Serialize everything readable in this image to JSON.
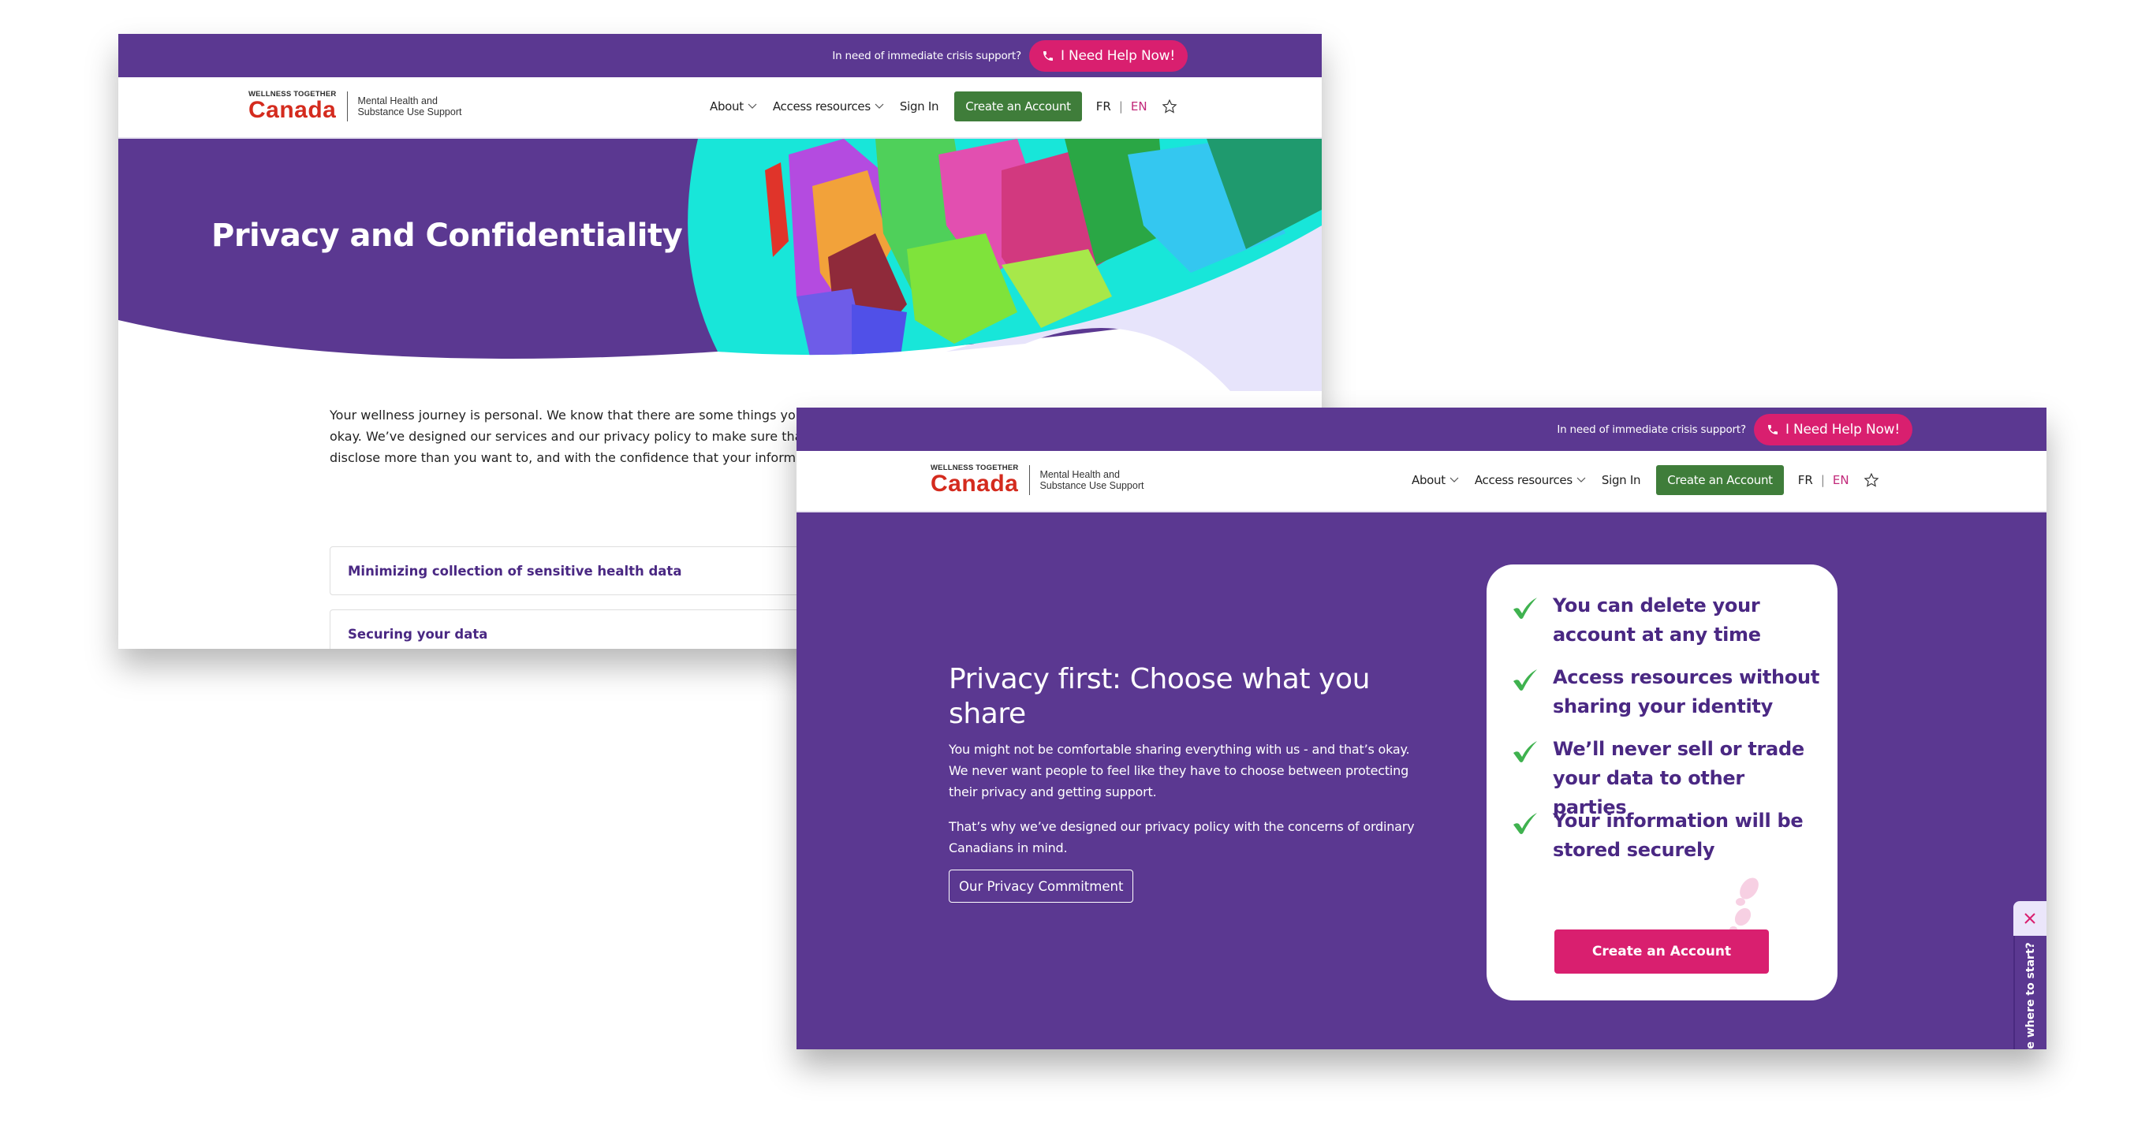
{
  "colors": {
    "brand_purple": "#5b3891",
    "text_purple": "#4a2883",
    "crisis_pink": "#d91f6f",
    "create_green": "#3f7d3a",
    "lang_active": "#c2287a",
    "check_green": "#3fb24f",
    "logo_red": "#d42b1e"
  },
  "crisis_bar": {
    "prompt": "In need of immediate crisis support?",
    "help_button": "I Need Help Now!",
    "help_icon": "phone-icon"
  },
  "header": {
    "logo": {
      "top_line": "WELLNESS TOGETHER",
      "name": "Canada",
      "subtitle_line1": "Mental Health and",
      "subtitle_line2": "Substance Use Support"
    },
    "nav": [
      {
        "label": "About",
        "icon": "chevron-down-icon"
      },
      {
        "label": "Access resources",
        "icon": "chevron-down-icon"
      },
      {
        "label": "Sign In"
      }
    ],
    "create_account": "Create an Account",
    "lang_fr": "FR",
    "lang_sep": "|",
    "lang_en": "EN",
    "favorite_icon": "star-icon"
  },
  "back_page": {
    "hero_title": "Privacy and Confidentiality",
    "intro_line1": "Your wellness journey is personal. We know that there are some things you",
    "intro_line2": "okay. We’ve designed our services and our privacy policy to make sure that",
    "intro_line3": "disclose more than you want to, and with the confidence that your informa",
    "accordion": [
      {
        "label": "Minimizing collection of sensitive health data"
      },
      {
        "label": "Securing your data"
      },
      {
        "label": ""
      }
    ]
  },
  "front_page": {
    "title": "Privacy first: Choose what you share",
    "paragraph1": "You might not be comfortable sharing everything with us - and that’s okay. We never want people to feel like they have to choose between protecting their privacy and getting support.",
    "paragraph2": "That’s why we’ve designed our privacy policy with the concerns of ordinary Canadians in mind.",
    "commitment_button": "Our Privacy Commitment",
    "card": {
      "items": [
        {
          "text": "You can delete your account at any time"
        },
        {
          "text": "Access resources without sharing your identity"
        },
        {
          "text": "We’ll never sell or trade your data to other parties"
        },
        {
          "text": "Your information will be stored securely"
        }
      ],
      "cta": "Create an Account"
    },
    "side_tab": {
      "label": "Not sure where to start?",
      "close_icon": "close-icon"
    }
  }
}
